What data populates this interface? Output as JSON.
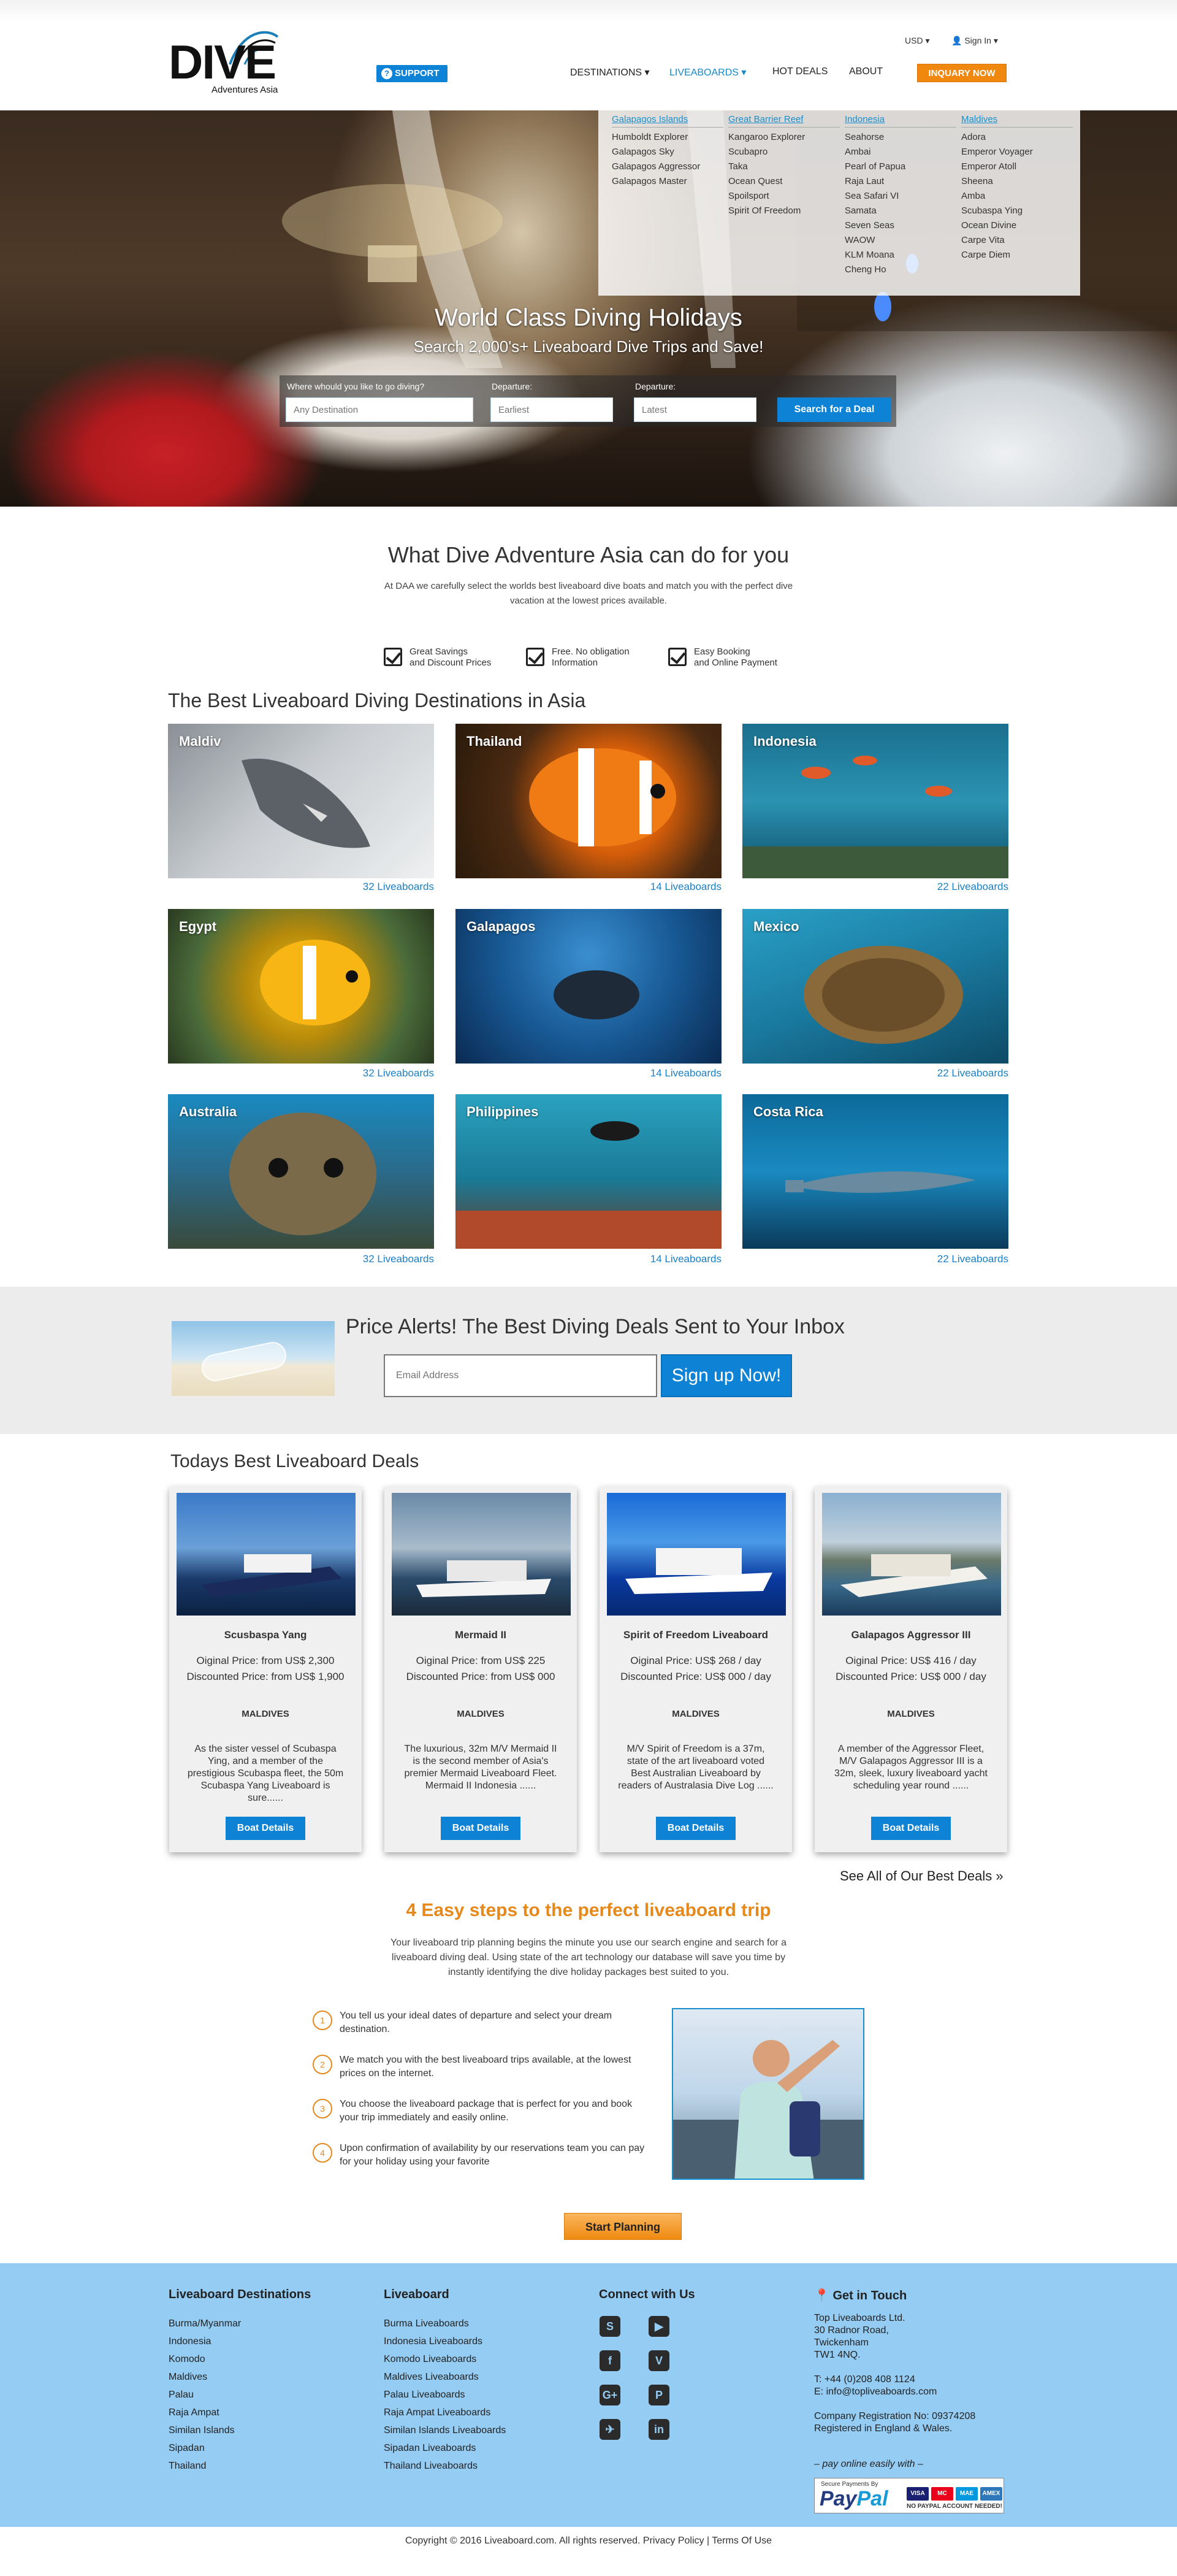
{
  "header": {
    "logo_text": "DIVE",
    "logo_tagline": "Adventures Asia",
    "support_label": "SUPPORT",
    "currency": "USD",
    "signin": "Sign In",
    "nav": [
      "DESTINATIONS",
      "LIVEABOARDS",
      "HOT DEALS",
      "ABOUT"
    ],
    "inquiry_label": "INQUARY NOW"
  },
  "dropdown": {
    "columns": [
      {
        "title": "Galapagos Islands",
        "items": [
          "Humboldt Explorer",
          "Galapagos Sky",
          "Galapagos Aggressor",
          "Galapagos Master"
        ]
      },
      {
        "title": "Great Barrier Reef",
        "items": [
          "Kangaroo Explorer",
          "Scubapro",
          "Taka",
          "Ocean Quest",
          "Spoilsport",
          "Spirit Of Freedom"
        ]
      },
      {
        "title": "Indonesia",
        "items": [
          "Seahorse",
          "Ambai",
          "Pearl of Papua",
          "Raja Laut",
          "Sea Safari VI",
          "Samata",
          "Seven Seas",
          "WAOW",
          "KLM Moana",
          "Cheng Ho"
        ]
      },
      {
        "title": "Maldives",
        "items": [
          "Adora",
          "Emperor Voyager",
          "Emperor Atoll",
          "Sheena",
          "Amba",
          "Scubaspa Ying",
          "Ocean Divine",
          "Carpe Vita",
          "Carpe Diem"
        ]
      }
    ]
  },
  "hero": {
    "title": "World Class Diving Holidays",
    "subtitle": "Search 2,000's+ Liveaboard Dive Trips and Save!",
    "where_label": "Where whould you like to go diving?",
    "where_placeholder": "Any Destination",
    "dep1_label": "Departure:",
    "dep1_placeholder": "Earliest",
    "dep2_label": "Departure:",
    "dep2_placeholder": "Latest",
    "search_button": "Search for a Deal"
  },
  "about": {
    "title": "What Dive Adventure Asia can do for you",
    "desc": "At DAA we carefully select the worlds best liveaboard dive boats and match you with the perfect dive vacation at the lowest prices available.",
    "features": [
      {
        "line1": "Great Savings",
        "line2": "and Discount Prices"
      },
      {
        "line1": "Free. No obligation",
        "line2": "Information"
      },
      {
        "line1": "Easy Booking",
        "line2": "and Online Payment"
      }
    ]
  },
  "destinations": {
    "title": "The Best Liveaboard Diving Destinations in Asia",
    "items": [
      {
        "name": "Maldiv",
        "count": "32 Liveaboards"
      },
      {
        "name": "Thailand",
        "count": "14 Liveaboards"
      },
      {
        "name": "Indonesia",
        "count": "22 Liveaboards"
      },
      {
        "name": "Egypt",
        "count": "32 Liveaboards"
      },
      {
        "name": "Galapagos",
        "count": "14 Liveaboards"
      },
      {
        "name": "Mexico",
        "count": "22 Liveaboards"
      },
      {
        "name": "Australia",
        "count": "32 Liveaboards"
      },
      {
        "name": "Philippines",
        "count": "14 Liveaboards"
      },
      {
        "name": "Costa Rica",
        "count": "22 Liveaboards"
      }
    ]
  },
  "alerts": {
    "title": "Price Alerts! The Best Diving Deals Sent to Your Inbox",
    "placeholder": "Email Address",
    "button": "Sign up Now!"
  },
  "deals": {
    "title": "Todays Best Liveaboard Deals",
    "items": [
      {
        "name": "Scusbaspa Yang",
        "price1": "Oiginal Price: from US$ 2,300",
        "price2": "Discounted Price: from US$ 1,900",
        "region": "MALDIVES",
        "desc": "As the sister vessel of Scubaspa Ying, and a member of the prestigious Scubaspa fleet, the 50m Scubaspa Yang Liveaboard is sure......",
        "button": "Boat Details"
      },
      {
        "name": "Mermaid II",
        "price1": "Oiginal Price: from US$ 225",
        "price2": "Discounted Price: from US$ 000",
        "region": "MALDIVES",
        "desc": "The luxurious, 32m M/V Mermaid II is the second member of Asia's premier Mermaid Liveaboard Fleet. Mermaid II Indonesia ......",
        "button": "Boat Details"
      },
      {
        "name": "Spirit of Freedom Liveaboard",
        "price1": "Oiginal Price: US$ 268 / day",
        "price2": "Discounted Price: US$ 000 / day",
        "region": "MALDIVES",
        "desc": "M/V Spirit of Freedom is a 37m, state of the art liveaboard voted Best Australian Liveaboard by readers of Australasia Dive Log ......",
        "button": "Boat Details"
      },
      {
        "name": "Galapagos Aggressor III",
        "price1": "Oiginal Price: US$ 416 / day",
        "price2": "Discounted Price: US$ 000 / day",
        "region": "MALDIVES",
        "desc": "A member of the Aggressor Fleet, M/V Galapagos Aggressor III is a 32m, sleek, luxury liveaboard yacht scheduling year round ......",
        "button": "Boat Details"
      }
    ],
    "see_all": "See All of Our Best Deals »"
  },
  "steps": {
    "title": "4 Easy steps to the perfect liveaboard trip",
    "desc": "Your liveaboard trip planning begins the minute you use our search engine and search for a liveaboard diving deal. Using state of the art technology our database will save you time by instantly identifying the dive holiday packages best suited to you.",
    "items": [
      {
        "num": "1",
        "text": "You tell us your ideal dates of departure and select your dream destination."
      },
      {
        "num": "2",
        "text": "We match you with the best liveaboard trips available, at the lowest prices on the internet."
      },
      {
        "num": "3",
        "text": " You choose the liveaboard package that is perfect for you and book your trip immediately and easily online."
      },
      {
        "num": "4",
        "text": "Upon confirmation of availability by our reservations team you can pay for your holiday using your favorite"
      }
    ],
    "button": "Start Planning"
  },
  "footer": {
    "col1_title": "Liveaboard Destinations",
    "col1_items": [
      "Burma/Myanmar",
      "Indonesia",
      "Komodo",
      "Maldives",
      "Palau",
      "Raja Ampat",
      "Similan Islands",
      "Sipadan",
      "Thailand"
    ],
    "col2_title": "Liveaboard",
    "col2_items": [
      "Burma Liveaboards",
      "Indonesia Liveaboards",
      "Komodo Liveaboards",
      "Maldives Liveaboards",
      "Palau Liveaboards",
      "Raja Ampat Liveaboards",
      "Similan Islands  Liveaboards",
      "Sipadan Liveaboards",
      "Thailand Liveaboards"
    ],
    "col3_title": "Connect with Us",
    "social": [
      "S",
      "▶",
      "f",
      "V",
      "G+",
      "P",
      "✈",
      "in"
    ],
    "col4_title": "Get in Touch",
    "address": [
      "Top Liveaboards Ltd.",
      "30 Radnor Road,",
      "Twickenham",
      "TW1 4NQ."
    ],
    "phone": "T: +44 (0)208 408 1124",
    "email": "E: info@topliveaboards.com",
    "reg1": "Company Registration No: 09374208",
    "reg2": "Registered in England & Wales.",
    "pay_online": "– pay online easily with –",
    "paypal_secure": "Secure Payments By",
    "paypal_pay": "Pay",
    "paypal_pal": "Pal",
    "paypal_note": "NO PAYPAL ACCOUNT NEEDED!",
    "cards": [
      "VISA",
      "MC",
      "MAE",
      "AMEX"
    ]
  },
  "copyright": "Copyright © 2016 Liveaboard.com. All rights reserved. Privacy Policy | Terms Of Use"
}
